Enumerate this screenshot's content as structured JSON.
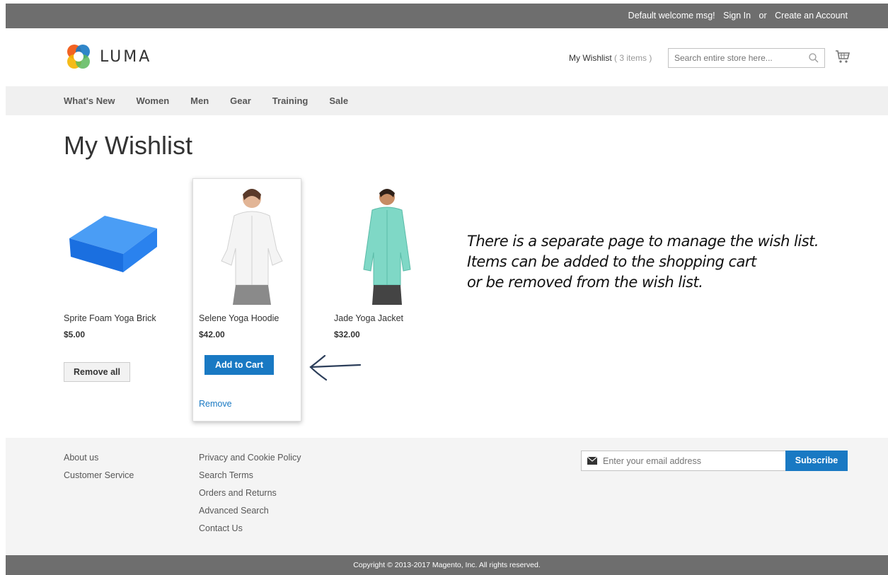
{
  "topbar": {
    "welcome": "Default welcome msg!",
    "sign_in": "Sign In",
    "or": "or",
    "create_account": "Create an Account"
  },
  "header": {
    "logo_text": "LUMA",
    "wishlist_label": "My Wishlist",
    "wishlist_count": "( 3 items )",
    "search_placeholder": "Search entire store here..."
  },
  "nav": {
    "items": [
      "What's New",
      "Women",
      "Men",
      "Gear",
      "Training",
      "Sale"
    ]
  },
  "main": {
    "title": "My Wishlist",
    "products": [
      {
        "name": "Sprite Foam Yoga Brick",
        "price": "$5.00"
      },
      {
        "name": "Selene Yoga Hoodie",
        "price": "$42.00"
      },
      {
        "name": "Jade Yoga Jacket",
        "price": "$32.00"
      }
    ],
    "remove_all_label": "Remove all",
    "add_to_cart_label": "Add to Cart",
    "remove_label": "Remove",
    "annotation_lines": [
      "There is a separate page to manage the wish list.",
      "Items can be added to the shopping cart",
      "or be removed from the wish list."
    ]
  },
  "footer": {
    "col1": [
      "About us",
      "Customer Service"
    ],
    "col2": [
      "Privacy and Cookie Policy",
      "Search Terms",
      "Orders and Returns",
      "Advanced Search",
      "Contact Us"
    ],
    "newsletter_placeholder": "Enter your email address",
    "subscribe_label": "Subscribe",
    "copyright": "Copyright © 2013-2017 Magento, Inc. All rights reserved."
  },
  "colors": {
    "accent": "#1979c3",
    "topbar": "#6e6e6e",
    "nav_bg": "#f0f0f0",
    "footer_bg": "#f4f4f4"
  },
  "icons": [
    "luma-logo-icon",
    "search-icon",
    "cart-icon",
    "envelope-icon",
    "arrow-left-icon"
  ]
}
